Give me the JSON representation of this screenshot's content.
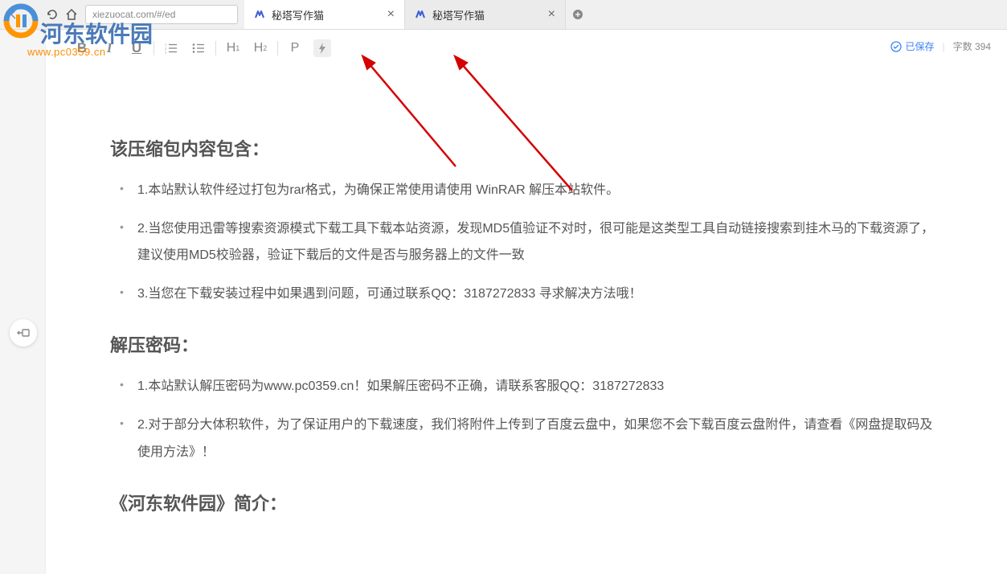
{
  "browser": {
    "url": "xiezuocat.com/#/ed",
    "tabs": [
      {
        "title": "秘塔写作猫",
        "active": true
      },
      {
        "title": "秘塔写作猫",
        "active": false
      }
    ]
  },
  "watermark": {
    "text_cn": "河东软件园",
    "url": "www.pc0359.cn"
  },
  "toolbar": {
    "bold": "B",
    "italic": "I",
    "underline": "U",
    "h1": "H",
    "h1_sub": "1",
    "h2": "H",
    "h2_sub": "2",
    "paragraph": "P",
    "flash": "⚡"
  },
  "status": {
    "saved": "已保存",
    "wordcount_label": "字数",
    "wordcount_value": "394"
  },
  "doc": {
    "section1_title": "该压缩包内容包含：",
    "section1_items": [
      "1.本站默认软件经过打包为rar格式，为确保正常使用请使用 WinRAR 解压本站软件。",
      "2.当您使用迅雷等搜索资源模式下载工具下载本站资源，发现MD5值验证不对时，很可能是这类型工具自动链接搜索到挂木马的下载资源了，建议使用MD5校验器，验证下载后的文件是否与服务器上的文件一致",
      "3.当您在下载安装过程中如果遇到问题，可通过联系QQ：3187272833 寻求解决方法哦！"
    ],
    "section2_title": "解压密码：",
    "section2_items": [
      "1.本站默认解压密码为www.pc0359.cn！如果解压密码不正确，请联系客服QQ：3187272833",
      "2.对于部分大体积软件，为了保证用户的下载速度，我们将附件上传到了百度云盘中，如果您不会下载百度云盘附件，请查看《网盘提取码及使用方法》！"
    ],
    "section3_title": "《河东软件园》简介："
  }
}
